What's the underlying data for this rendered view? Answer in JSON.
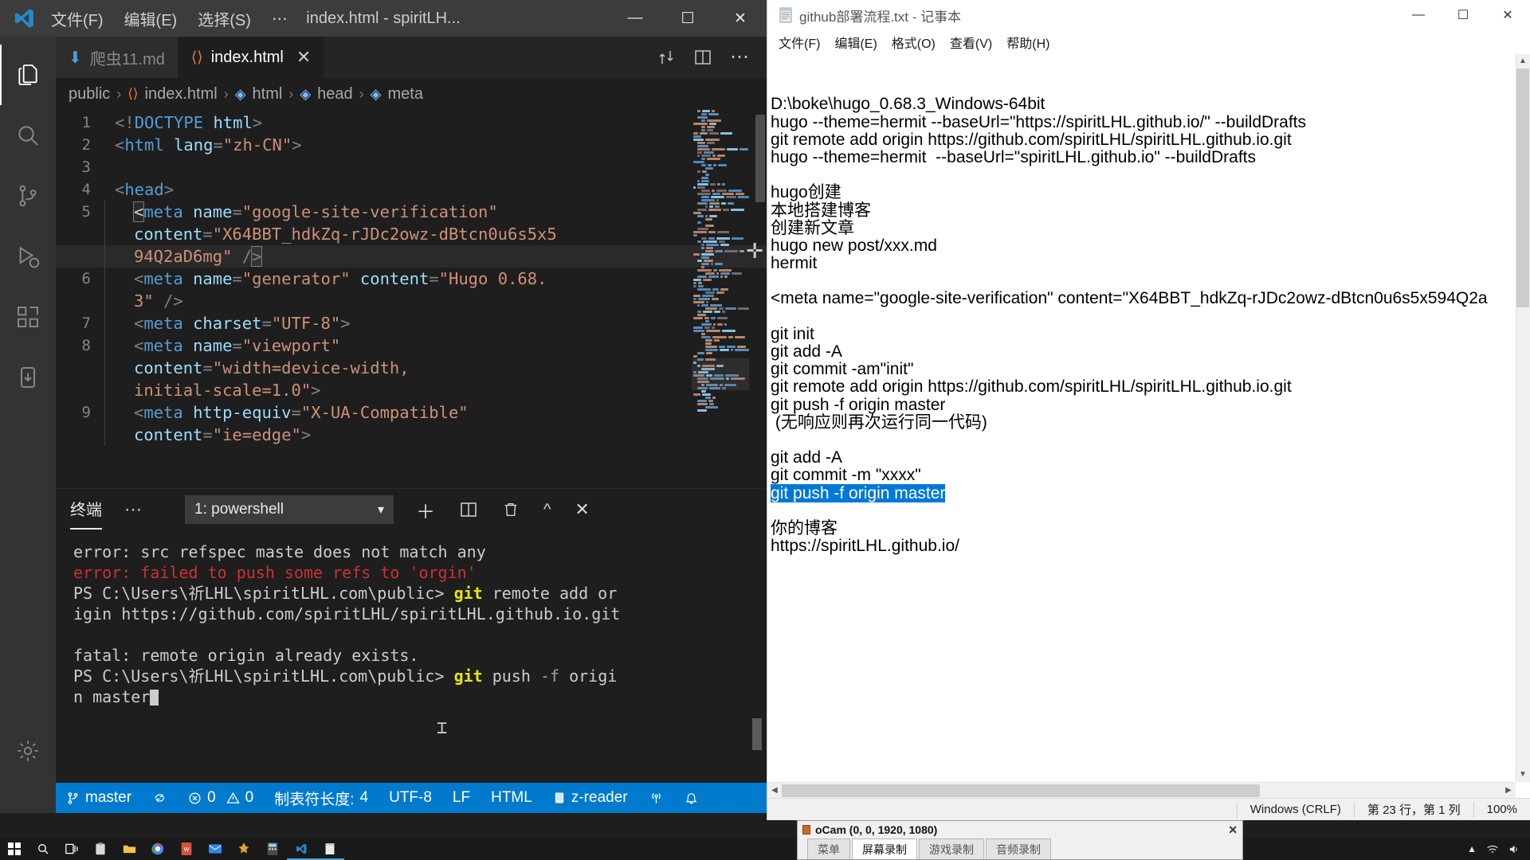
{
  "vscode": {
    "window_title": "index.html - spiritLH...",
    "menu": [
      "文件(F)",
      "编辑(E)",
      "选择(S)",
      "⋯"
    ],
    "window_buttons": {
      "minimize": "—",
      "maximize": "☐",
      "close": "✕"
    },
    "activitybar": [
      {
        "name": "explorer",
        "label": "资源管理器"
      },
      {
        "name": "search",
        "label": "搜索"
      },
      {
        "name": "source-control",
        "label": "源代码管理"
      },
      {
        "name": "run-debug",
        "label": "运行和调试"
      },
      {
        "name": "extensions",
        "label": "扩展"
      },
      {
        "name": "download",
        "label": "下载"
      },
      {
        "name": "settings",
        "label": "管理"
      }
    ],
    "tabs": [
      {
        "label": "爬虫11.md",
        "icon": "markdown-icon",
        "active": false,
        "dirty": false
      },
      {
        "label": "index.html",
        "icon": "html-icon",
        "active": true,
        "close": "✕"
      }
    ],
    "tab_actions": [
      "split-compare-icon",
      "split-editor-icon",
      "more-actions-icon"
    ],
    "breadcrumb": [
      "public",
      "index.html",
      "html",
      "head",
      "meta"
    ],
    "code": [
      {
        "num": "1",
        "indent": 0,
        "parts": [
          {
            "t": "punct",
            "v": "<!"
          },
          {
            "t": "tag",
            "v": "DOCTYPE"
          },
          {
            "t": "plain",
            "v": " "
          },
          {
            "t": "name",
            "v": "html"
          },
          {
            "t": "punct",
            "v": ">"
          }
        ]
      },
      {
        "num": "2",
        "indent": 0,
        "parts": [
          {
            "t": "punct",
            "v": "<"
          },
          {
            "t": "tag",
            "v": "html"
          },
          {
            "t": "plain",
            "v": " "
          },
          {
            "t": "name",
            "v": "lang"
          },
          {
            "t": "punct",
            "v": "="
          },
          {
            "t": "str",
            "v": "\"zh-CN\""
          },
          {
            "t": "punct",
            "v": ">"
          }
        ]
      },
      {
        "num": "3",
        "indent": 0,
        "parts": []
      },
      {
        "num": "4",
        "indent": 0,
        "parts": [
          {
            "t": "punct",
            "v": "<"
          },
          {
            "t": "tag",
            "v": "head"
          },
          {
            "t": "punct",
            "v": ">"
          }
        ]
      },
      {
        "num": "5",
        "indent": 1,
        "cursorStart": true,
        "parts": [
          {
            "t": "punct",
            "v": "<"
          },
          {
            "t": "tag",
            "v": "meta"
          },
          {
            "t": "plain",
            "v": " "
          },
          {
            "t": "name",
            "v": "name"
          },
          {
            "t": "punct",
            "v": "="
          },
          {
            "t": "str",
            "v": "\"google-site-verification\""
          }
        ]
      },
      {
        "num": "",
        "indent": 1,
        "wrap": true,
        "parts": [
          {
            "t": "name",
            "v": "content"
          },
          {
            "t": "punct",
            "v": "="
          },
          {
            "t": "str",
            "v": "\"X64BBT_hdkZq-rJDc2owz-dBtcn0u6s5x5"
          }
        ]
      },
      {
        "num": "",
        "indent": 1,
        "wrap": true,
        "highlight": true,
        "cursorEnd": true,
        "parts": [
          {
            "t": "str",
            "v": "94Q2aD6mg\""
          },
          {
            "t": "plain",
            "v": " "
          },
          {
            "t": "punct",
            "v": "/"
          }
        ]
      },
      {
        "num": "6",
        "indent": 1,
        "parts": [
          {
            "t": "punct",
            "v": "<"
          },
          {
            "t": "tag",
            "v": "meta"
          },
          {
            "t": "plain",
            "v": " "
          },
          {
            "t": "name",
            "v": "name"
          },
          {
            "t": "punct",
            "v": "="
          },
          {
            "t": "str",
            "v": "\"generator\""
          },
          {
            "t": "plain",
            "v": " "
          },
          {
            "t": "name",
            "v": "content"
          },
          {
            "t": "punct",
            "v": "="
          },
          {
            "t": "str",
            "v": "\"Hugo 0.68."
          }
        ]
      },
      {
        "num": "",
        "indent": 1,
        "wrap": true,
        "parts": [
          {
            "t": "str",
            "v": "3\""
          },
          {
            "t": "plain",
            "v": " "
          },
          {
            "t": "punct",
            "v": "/>"
          }
        ]
      },
      {
        "num": "7",
        "indent": 1,
        "parts": [
          {
            "t": "punct",
            "v": "<"
          },
          {
            "t": "tag",
            "v": "meta"
          },
          {
            "t": "plain",
            "v": " "
          },
          {
            "t": "name",
            "v": "charset"
          },
          {
            "t": "punct",
            "v": "="
          },
          {
            "t": "str",
            "v": "\"UTF-8\""
          },
          {
            "t": "punct",
            "v": ">"
          }
        ]
      },
      {
        "num": "8",
        "indent": 1,
        "parts": [
          {
            "t": "punct",
            "v": "<"
          },
          {
            "t": "tag",
            "v": "meta"
          },
          {
            "t": "plain",
            "v": " "
          },
          {
            "t": "name",
            "v": "name"
          },
          {
            "t": "punct",
            "v": "="
          },
          {
            "t": "str",
            "v": "\"viewport\""
          }
        ]
      },
      {
        "num": "",
        "indent": 1,
        "wrap": true,
        "parts": [
          {
            "t": "name",
            "v": "content"
          },
          {
            "t": "punct",
            "v": "="
          },
          {
            "t": "str",
            "v": "\"width=device-width,"
          }
        ]
      },
      {
        "num": "",
        "indent": 1,
        "wrap": true,
        "parts": [
          {
            "t": "str",
            "v": "initial-scale=1.0\""
          },
          {
            "t": "punct",
            "v": ">"
          }
        ]
      },
      {
        "num": "9",
        "indent": 1,
        "parts": [
          {
            "t": "punct",
            "v": "<"
          },
          {
            "t": "tag",
            "v": "meta"
          },
          {
            "t": "plain",
            "v": " "
          },
          {
            "t": "name",
            "v": "http-equiv"
          },
          {
            "t": "punct",
            "v": "="
          },
          {
            "t": "str",
            "v": "\"X-UA-Compatible\""
          }
        ]
      },
      {
        "num": "",
        "indent": 1,
        "wrap": true,
        "parts": [
          {
            "t": "name",
            "v": "content"
          },
          {
            "t": "punct",
            "v": "="
          },
          {
            "t": "str",
            "v": "\"ie=edge\""
          },
          {
            "t": "punct",
            "v": ">"
          }
        ]
      }
    ],
    "panel": {
      "tab_label": "终端",
      "more_label": "⋯",
      "terminal_selected": "1: powershell",
      "terminal_options": [
        "1: powershell"
      ],
      "actions": [
        "new-terminal-icon",
        "split-terminal-icon",
        "kill-terminal-icon",
        "maximize-panel-icon",
        "close-panel-icon"
      ],
      "output": [
        {
          "style": "plain",
          "text": "error: src refspec maste does not match any"
        },
        {
          "style": "error",
          "text": "error: failed to push some refs to 'orgin'"
        },
        {
          "style": "prompt",
          "prefix": "PS C:\\Users\\祈LHL\\spiritLHL.com\\public> ",
          "cmd": "git",
          "rest": " remote add or"
        },
        {
          "style": "plain",
          "text": "igin https://github.com/spiritLHL/spiritLHL.github.io.git"
        },
        {
          "style": "plain",
          "text": ""
        },
        {
          "style": "plain",
          "text": "fatal: remote origin already exists."
        },
        {
          "style": "prompt",
          "prefix": "PS C:\\Users\\祈LHL\\spiritLHL.com\\public> ",
          "cmd": "git",
          "rest": " push ",
          "flag": "-f",
          "rest2": " origi"
        },
        {
          "style": "cursorline",
          "text": "n master"
        }
      ]
    },
    "statusbar": {
      "branch_icon": "source-control-icon",
      "branch": "master",
      "sync_icon": "sync-icon",
      "errors_icon": "error-icon",
      "errors": "0",
      "warnings_icon": "warning-icon",
      "warnings": "0",
      "tab_size_label": "制表符长度:",
      "tab_size": "4",
      "encoding": "UTF-8",
      "eol": "LF",
      "language": "HTML",
      "zreader_icon": "book-icon",
      "zreader": "z-reader",
      "remote_icon": "broadcast-icon",
      "bell_icon": "bell-icon"
    }
  },
  "notepad": {
    "title": "github部署流程.txt - 记事本",
    "icon": "notepad-icon",
    "window_buttons": {
      "minimize": "—",
      "maximize": "☐",
      "close": "✕"
    },
    "menu": [
      "文件(F)",
      "编辑(E)",
      "格式(O)",
      "查看(V)",
      "帮助(H)"
    ],
    "lines": [
      {
        "text": "D:\\boke\\hugo_0.68.3_Windows-64bit"
      },
      {
        "text": "hugo --theme=hermit --baseUrl=\"https://spiritLHL.github.io/\" --buildDrafts"
      },
      {
        "text": "git remote add origin https://github.com/spiritLHL/spiritLHL.github.io.git"
      },
      {
        "text": "hugo --theme=hermit  --baseUrl=\"spiritLHL.github.io\" --buildDrafts"
      },
      {
        "text": ""
      },
      {
        "text": "hugo创建"
      },
      {
        "text": "本地搭建博客"
      },
      {
        "text": "创建新文章"
      },
      {
        "text": "hugo new post/xxx.md"
      },
      {
        "text": "hermit"
      },
      {
        "text": ""
      },
      {
        "text": "<meta name=\"google-site-verification\" content=\"X64BBT_hdkZq-rJDc2owz-dBtcn0u6s5x594Q2a"
      },
      {
        "text": ""
      },
      {
        "text": "git init"
      },
      {
        "text": "git add -A"
      },
      {
        "text": "git commit -am\"init\""
      },
      {
        "text": "git remote add origin https://github.com/spiritLHL/spiritLHL.github.io.git"
      },
      {
        "text": "git push -f origin master"
      },
      {
        "text": " (无响应则再次运行同一代码)"
      },
      {
        "text": ""
      },
      {
        "text": "git add -A"
      },
      {
        "text": "git commit -m \"xxxx\""
      },
      {
        "text": "git push -f origin master",
        "selected": true
      },
      {
        "text": ""
      },
      {
        "text": "你的博客"
      },
      {
        "text": "https://spiritLHL.github.io/"
      }
    ],
    "statusbar": {
      "eol": "Windows (CRLF)",
      "position": "第 23 行，第 1 列",
      "zoom": "100%"
    }
  },
  "taskbar": {
    "items": [
      "start-icon",
      "search-icon",
      "task-view-icon",
      "clipboard-icon",
      "folder-icon",
      "chrome-icon",
      "wps-icon",
      "mail-icon",
      "pin-icon",
      "calc-icon",
      "vscode-icon",
      "notepad-icon"
    ],
    "tray": [
      "network-icon",
      "volume-icon",
      "chevron-up-icon"
    ]
  },
  "ocam": {
    "title": "oCam (0, 0, 1920, 1080)",
    "close": "✕",
    "tabs": [
      {
        "label": "菜单",
        "active": false
      },
      {
        "label": "屏幕录制",
        "active": true
      },
      {
        "label": "游戏录制",
        "active": false
      },
      {
        "label": "音频录制",
        "active": false
      }
    ]
  }
}
